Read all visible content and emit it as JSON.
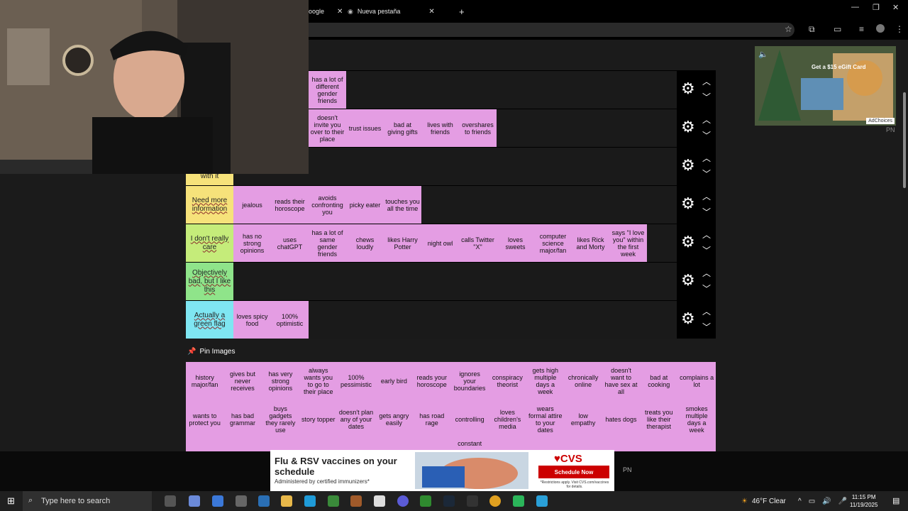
{
  "browser": {
    "tabs": [
      {
        "label": "oogle"
      },
      {
        "label": "Nueva pestaña"
      }
    ],
    "new_tab_label": "+"
  },
  "tiers": [
    {
      "label": "",
      "color": "#1a1a1a",
      "items": [
        "has a lot of different gender friends"
      ]
    },
    {
      "label": "",
      "color": "#1a1a1a",
      "items": [
        "doesn't invite you over to their place",
        "trust issues",
        "bad at giving gifts",
        "lives with friends",
        "overshares to friends"
      ]
    },
    {
      "label": "with it",
      "color": "#f6e27a",
      "items": []
    },
    {
      "label": "Need more information",
      "color": "#f6e27a",
      "items": [
        "jealous",
        "reads their horoscope",
        "avoids confronting you",
        "picky eater",
        "touches you all the time"
      ]
    },
    {
      "label": "I don't really care",
      "color": "#c5ec7a",
      "items": [
        "has no strong opinions",
        "uses chatGPT",
        "has a lot of same gender friends",
        "chews loudly",
        "likes Harry Potter",
        "night owl",
        "calls Twitter \"X\"",
        "loves sweets",
        "computer science major/fan",
        "likes Rick and Morty",
        "says \"I love you\" within the first week"
      ]
    },
    {
      "label": "Objectively bad, but I like this",
      "color": "#8fe48a",
      "items": []
    },
    {
      "label": "Actually a green flag",
      "color": "#7fe6f2",
      "items": [
        "loves spicy food",
        "100% optimistic"
      ]
    }
  ],
  "pin_images_label": "Pin Images",
  "pool_items": [
    "history major/fan",
    "gives but never receives",
    "has very strong opinions",
    "always wants you to go to their place",
    "100% pessimistic",
    "early bird",
    "reads your horoscope",
    "ignores your boundaries",
    "conspiracy theorist",
    "gets high multiple days a week",
    "chronically online",
    "doesn't want to have sex at all",
    "bad at cooking",
    "complains a lot",
    "wants to protect you",
    "has bad grammar",
    "buys gadgets they rarely use",
    "story topper",
    "doesn't plan any of your dates",
    "gets angry easily",
    "has road rage",
    "controlling",
    "loves children's media",
    "wears formal attire to your dates",
    "low empathy",
    "hates dogs",
    "treats you like their therapist",
    "smokes multiple days a week"
  ],
  "pool_partial_items": [
    "constant"
  ],
  "ads": {
    "right": {
      "headline": "Get a $15 eGift Card",
      "adchoices": "AdChoices",
      "tag": "PN"
    },
    "bottom": {
      "headline": "Flu & RSV vaccines on your schedule",
      "sub": "Administered by certified immunizers*",
      "brand": "♥CVS",
      "button": "Schedule Now",
      "fine": "*Restrictions apply. Visit CVS.com/vaccines for details.",
      "tag": "PN"
    }
  },
  "taskbar": {
    "search_placeholder": "Type here to search",
    "weather": "46°F  Clear",
    "time": "11:15 PM",
    "date": "11/19/2025"
  }
}
